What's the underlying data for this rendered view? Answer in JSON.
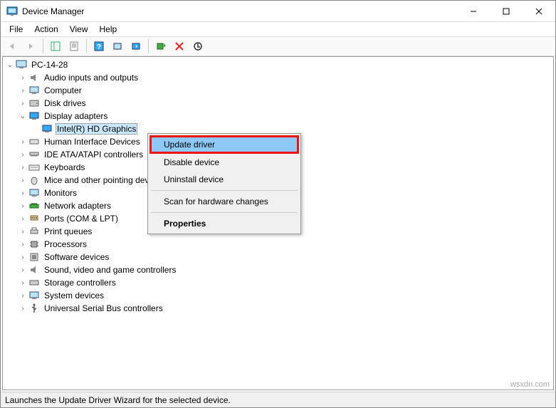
{
  "window": {
    "title": "Device Manager"
  },
  "menu": {
    "file": "File",
    "action": "Action",
    "view": "View",
    "help": "Help"
  },
  "tree": {
    "root": "PC-14-28",
    "items": [
      "Audio inputs and outputs",
      "Computer",
      "Disk drives",
      "Display adapters",
      "Intel(R) HD Graphics",
      "Human Interface Devices",
      "IDE ATA/ATAPI controllers",
      "Keyboards",
      "Mice and other pointing devices",
      "Monitors",
      "Network adapters",
      "Ports (COM & LPT)",
      "Print queues",
      "Processors",
      "Software devices",
      "Sound, video and game controllers",
      "Storage controllers",
      "System devices",
      "Universal Serial Bus controllers"
    ]
  },
  "context": {
    "update": "Update driver",
    "disable": "Disable device",
    "uninstall": "Uninstall device",
    "scan": "Scan for hardware changes",
    "properties": "Properties"
  },
  "status": "Launches the Update Driver Wizard for the selected device.",
  "watermark": "wsxdn.com"
}
